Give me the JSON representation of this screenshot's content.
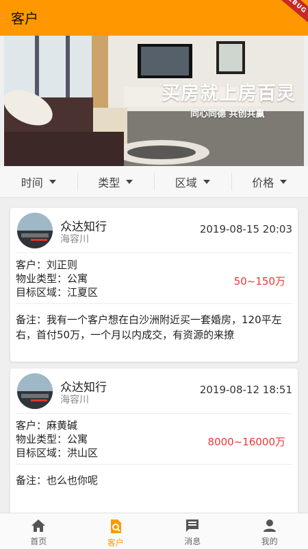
{
  "appbar": {
    "title": "客户",
    "debug_ribbon": "DEBUG"
  },
  "banner": {
    "slogan": "买房就上房百灵",
    "subslogan": "同心同德 共创共赢"
  },
  "filters": [
    {
      "label": "时间"
    },
    {
      "label": "类型"
    },
    {
      "label": "区域"
    },
    {
      "label": "价格"
    }
  ],
  "cards": [
    {
      "company": "众达知行",
      "contact": "海容川",
      "time": "2019-08-15 20:03",
      "client": "客户：刘正则",
      "property_type": "物业类型：公寓",
      "target_area": "目标区域：江夏区",
      "price": "50~150万",
      "remark": "备注：我有一个客户想在白沙洲附近买一套婚房，120平左右，首付50万，一个月以内成交，有资源的来撩"
    },
    {
      "company": "众达知行",
      "contact": "海容川",
      "time": "2019-08-12 18:51",
      "client": "客户：麻黄碱",
      "property_type": "物业类型：公寓",
      "target_area": "目标区域：洪山区",
      "price": "8000~16000万",
      "remark": "备注：也么也你呢"
    }
  ],
  "tabs": [
    {
      "label": "首页",
      "icon": "home-icon"
    },
    {
      "label": "客户",
      "icon": "customer-search-icon",
      "active": true
    },
    {
      "label": "消息",
      "icon": "message-icon"
    },
    {
      "label": "我的",
      "icon": "person-icon"
    }
  ],
  "colors": {
    "accent": "#ff9800",
    "price": "#e53935"
  }
}
